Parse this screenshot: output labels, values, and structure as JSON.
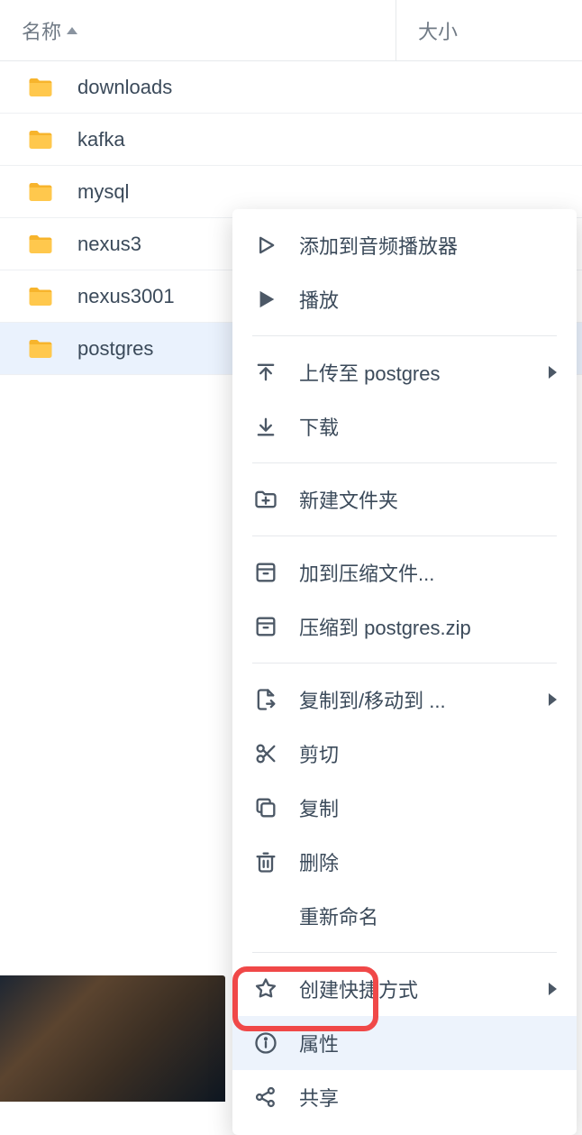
{
  "table": {
    "name_header": "名称",
    "size_header": "大小"
  },
  "folders": [
    {
      "name": "downloads"
    },
    {
      "name": "kafka"
    },
    {
      "name": "mysql"
    },
    {
      "name": "nexus3"
    },
    {
      "name": "nexus3001"
    },
    {
      "name": "postgres",
      "selected": true
    }
  ],
  "context_menu": {
    "groups": [
      [
        {
          "id": "add-audio",
          "label": "添加到音频播放器",
          "icon": "play-outline"
        },
        {
          "id": "play",
          "label": "播放",
          "icon": "play-solid"
        }
      ],
      [
        {
          "id": "upload-to",
          "label": "上传至 postgres",
          "icon": "upload",
          "submenu": true
        },
        {
          "id": "download",
          "label": "下载",
          "icon": "download"
        }
      ],
      [
        {
          "id": "new-folder",
          "label": "新建文件夹",
          "icon": "folder-plus"
        }
      ],
      [
        {
          "id": "add-arch",
          "label": "加到压缩文件...",
          "icon": "archive"
        },
        {
          "id": "zip-to",
          "label": "压缩到 postgres.zip",
          "icon": "archive"
        }
      ],
      [
        {
          "id": "copy-move",
          "label": "复制到/移动到 ...",
          "icon": "file-arrow",
          "submenu": true
        },
        {
          "id": "cut",
          "label": "剪切",
          "icon": "cut"
        },
        {
          "id": "copy",
          "label": "复制",
          "icon": "copy"
        },
        {
          "id": "delete",
          "label": "删除",
          "icon": "trash"
        },
        {
          "id": "rename",
          "label": "重新命名",
          "icon": ""
        }
      ],
      [
        {
          "id": "shortcut",
          "label": "创建快捷方式",
          "icon": "star",
          "submenu": true
        },
        {
          "id": "props",
          "label": "属性",
          "icon": "info",
          "hovered": true
        },
        {
          "id": "share",
          "label": "共享",
          "icon": "share"
        }
      ]
    ]
  }
}
